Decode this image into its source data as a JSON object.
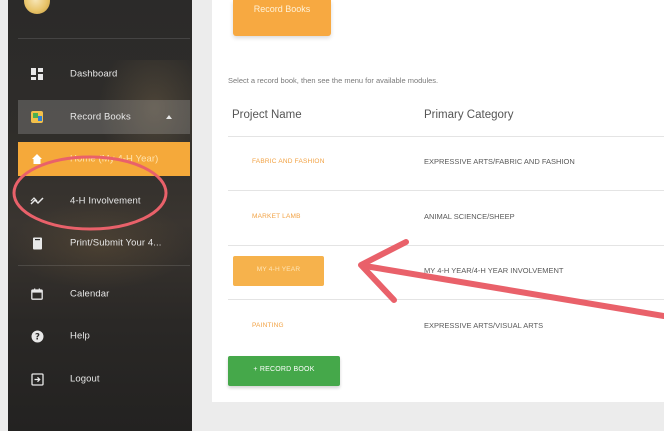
{
  "sidebar": {
    "items": [
      {
        "key": "dashboard",
        "label": "Dashboard",
        "icon": "dashboard-icon"
      },
      {
        "key": "record-books",
        "label": "Record Books",
        "icon": "record-book-icon"
      },
      {
        "key": "home",
        "label": "Home (My 4-H Year)",
        "icon": "home-icon"
      },
      {
        "key": "involvement",
        "label": "4-H Involvement",
        "icon": "trend-icon"
      },
      {
        "key": "print",
        "label": "Print/Submit Your 4...",
        "icon": "book-icon"
      },
      {
        "key": "calendar",
        "label": "Calendar",
        "icon": "calendar-icon"
      },
      {
        "key": "help",
        "label": "Help",
        "icon": "help-icon"
      },
      {
        "key": "logout",
        "label": "Logout",
        "icon": "logout-icon"
      }
    ]
  },
  "main": {
    "top_button": "Record Books",
    "instructions": "Select a record book, then see the menu for available modules.",
    "columns": [
      "Project Name",
      "Primary Category"
    ],
    "rows": [
      {
        "project": "FABRIC AND FASHION",
        "category": "EXPRESSIVE ARTS/FABRIC AND FASHION"
      },
      {
        "project": "MARKET LAMB",
        "category": "ANIMAL SCIENCE/SHEEP"
      },
      {
        "project": "MY 4-H YEAR",
        "category": "MY 4-H YEAR/4-H YEAR INVOLVEMENT"
      },
      {
        "project": "PAINTING",
        "category": "EXPRESSIVE ARTS/VISUAL ARTS"
      }
    ],
    "add_button": "+ RECORD BOOK"
  },
  "colors": {
    "accent_orange": "#f5a93a",
    "add_green": "#45a84a",
    "annotation_red": "#e9616a"
  }
}
